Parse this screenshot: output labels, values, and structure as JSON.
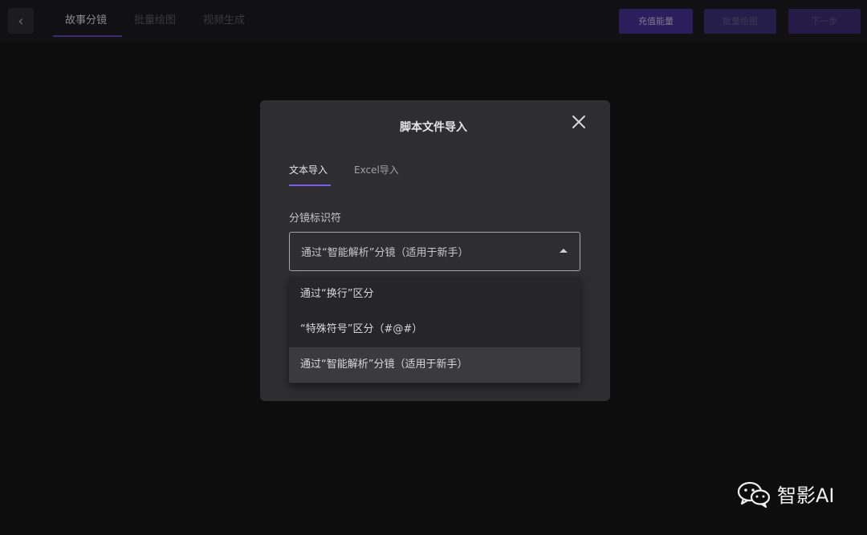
{
  "topbar": {
    "tabs": [
      {
        "label": "故事分镜",
        "active": true
      },
      {
        "label": "批量绘图",
        "active": false
      },
      {
        "label": "视频生成",
        "active": false
      }
    ],
    "buttons": {
      "recharge": "充值能量",
      "batch": "批量绘图",
      "next": "下一步"
    }
  },
  "modal": {
    "title": "脚本文件导入",
    "tabs": [
      "文本导入",
      "Excel导入"
    ],
    "field_label": "分镜标识符",
    "select_value": "通过“智能解析”分镜（适用于新手）",
    "options": [
      "通过“换行”区分",
      "“特殊符号”区分（#@#）",
      "通过“智能解析”分镜（适用于新手）"
    ],
    "selected_index": 2
  },
  "watermark": {
    "text": "智影AI",
    "icon": "wechat-icon"
  },
  "colors": {
    "accent": "#7b5cf0",
    "modal_bg": "#2e2e31",
    "page_bg": "#0d0d0e"
  }
}
